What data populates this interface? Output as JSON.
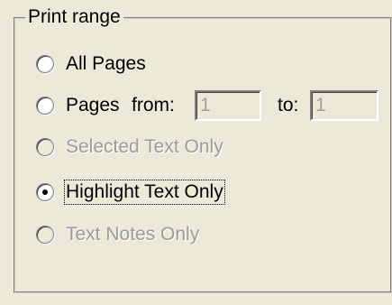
{
  "group": {
    "title": "Print range"
  },
  "options": {
    "all_pages": "All Pages",
    "pages": "Pages",
    "selected_text": "Selected Text Only",
    "highlight_text": "Highlight Text Only",
    "text_notes": "Text Notes Only"
  },
  "range": {
    "from_label": "from:",
    "from_value": "1",
    "to_label": "to:",
    "to_value": "1"
  },
  "selected_option": "highlight_text"
}
